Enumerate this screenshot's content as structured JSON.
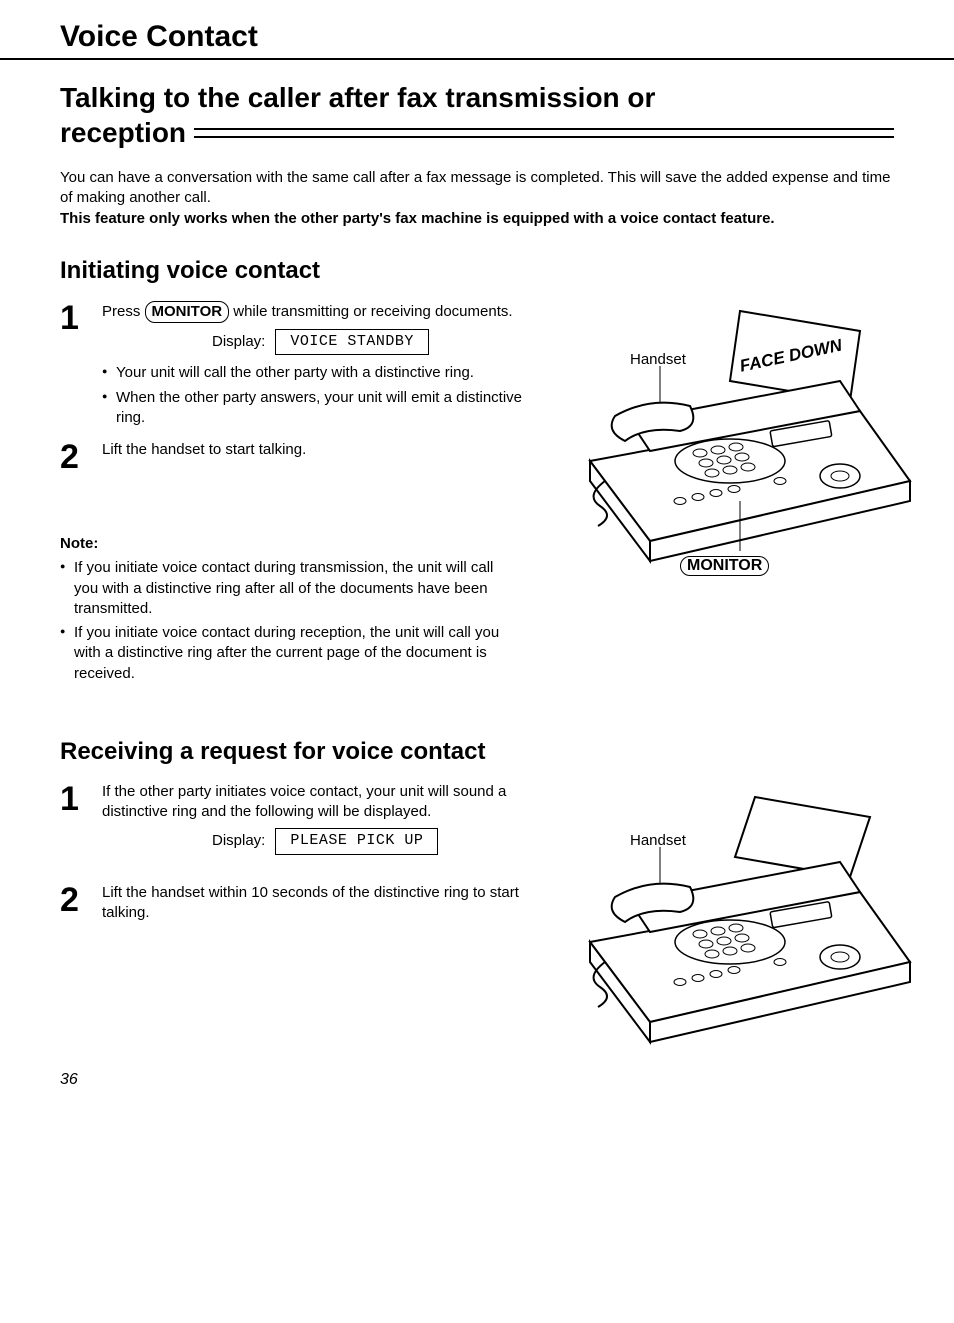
{
  "header": "Voice Contact",
  "title_line1": "Talking to the caller after fax transmission or",
  "title_line2": "reception",
  "intro1": "You can have a conversation with the same call after a fax message is completed. This will save the added expense and time of making another call.",
  "intro2": "This feature only works when the other party's fax machine is equipped with a voice contact feature.",
  "section1_head": "Initiating voice contact",
  "s1_step1_a": "Press ",
  "s1_step1_key": "MONITOR",
  "s1_step1_b": " while transmitting or receiving documents.",
  "display_label": "Display:",
  "display1": "VOICE STANDBY",
  "s1_step1_bul1": "Your unit will call the other party with a distinctive ring.",
  "s1_step1_bul2": "When the other party answers, your unit will emit a distinctive ring.",
  "s1_step2": "Lift the handset to start talking.",
  "note_head": "Note:",
  "note_bul1": "If you initiate voice contact during transmission, the unit will call you with a distinctive ring after all of the documents have been transmitted.",
  "note_bul2": "If you initiate voice contact during reception, the unit will call you with a distinctive ring after the current page of the document is received.",
  "section2_head": "Receiving a request for voice contact",
  "s2_step1": "If the other party initiates voice contact, your unit will sound a distinctive ring and the following will be displayed.",
  "display2": "PLEASE PICK UP",
  "s2_step2": "Lift the handset within 10 seconds of the distinctive ring to start talking.",
  "fig1_handset": "Handset",
  "fig1_facedown": "FACE DOWN",
  "fig1_monitor": "MONITOR",
  "fig2_handset": "Handset",
  "page_number": "36",
  "num1": "1",
  "num2": "2"
}
